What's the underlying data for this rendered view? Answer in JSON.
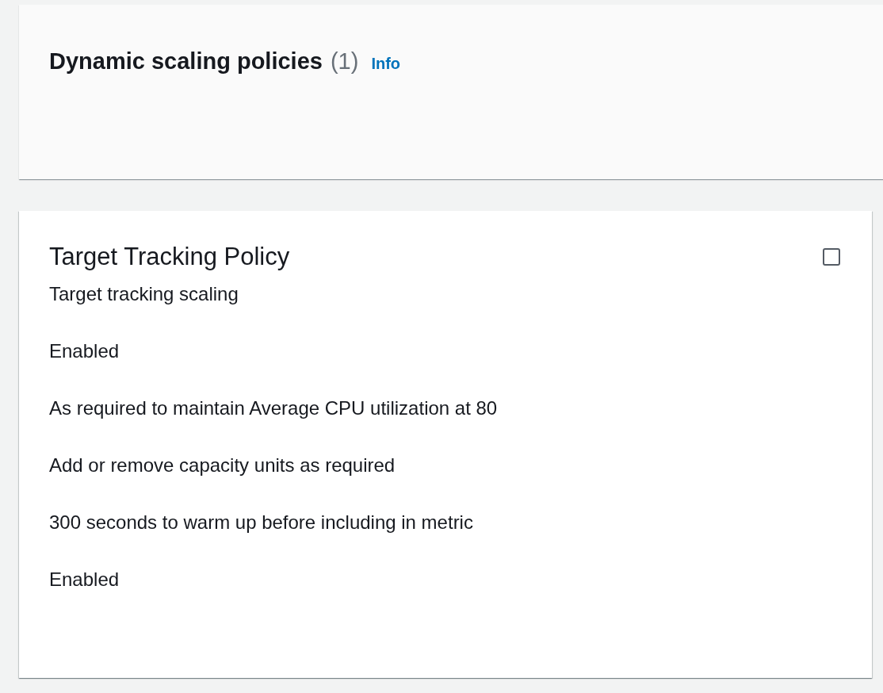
{
  "header": {
    "title": "Dynamic scaling policies",
    "count": "(1)",
    "info_link": "Info"
  },
  "policies": [
    {
      "title": "Target Tracking Policy",
      "selected": false,
      "details": [
        "Target tracking scaling",
        "Enabled",
        "As required to maintain Average CPU utilization at 80",
        "Add or remove capacity units as required",
        "300 seconds to warm up before including in metric",
        "Enabled"
      ]
    }
  ]
}
